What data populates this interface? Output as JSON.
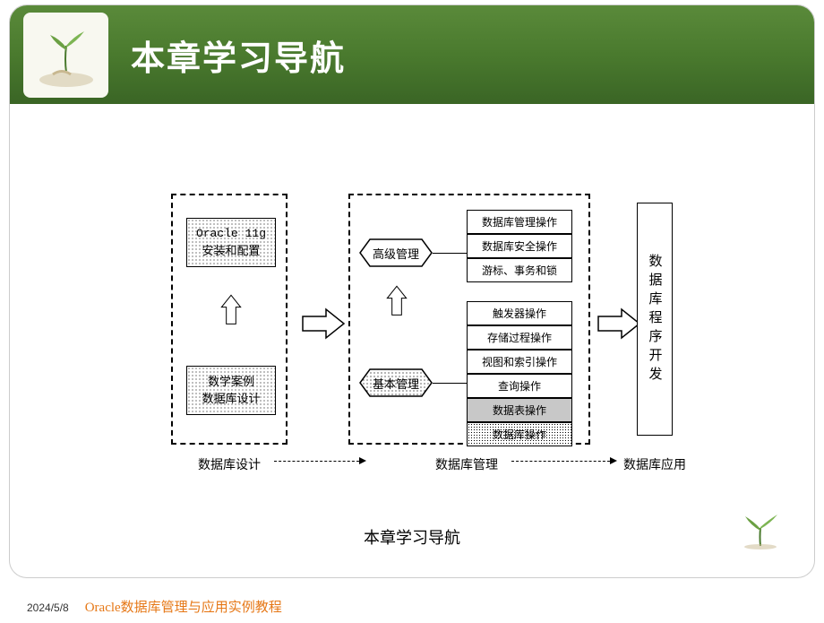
{
  "header": {
    "title": "本章学习导航"
  },
  "diagram": {
    "col1": {
      "oracle_line1": "Oracle 11g",
      "oracle_line2": "安装和配置",
      "case_line1": "数学案例",
      "case_line2": "数据库设计",
      "label": "数据库设计"
    },
    "col2": {
      "hex_advanced": "高级管理",
      "hex_basic": "基本管理",
      "top_stack": [
        "数据库管理操作",
        "数据库安全操作",
        "游标、事务和锁"
      ],
      "bottom_stack": [
        "触发器操作",
        "存储过程操作",
        "视图和索引操作",
        "查询操作",
        "数据表操作",
        "数据库操作"
      ],
      "label": "数据库管理"
    },
    "col3": {
      "text": "数据库程序开发",
      "label": "数据库应用"
    }
  },
  "caption": "本章学习导航",
  "footer": {
    "date": "2024/5/8",
    "title": "Oracle数据库管理与应用实例教程"
  }
}
